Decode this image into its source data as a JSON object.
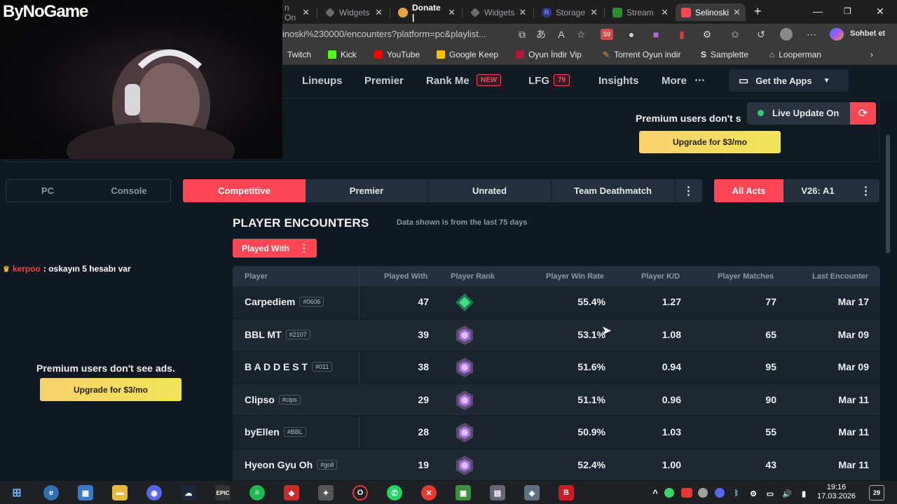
{
  "overlay": {
    "logo": "ByNoGame"
  },
  "browser": {
    "tabs": [
      {
        "label": "n On",
        "active": false
      },
      {
        "label": "Widgets",
        "active": false
      },
      {
        "label": "Donate |",
        "active": false
      },
      {
        "label": "Widgets",
        "active": false
      },
      {
        "label": "Storage",
        "active": false
      },
      {
        "label": "Stream",
        "active": false
      },
      {
        "label": "Selinoski",
        "active": true
      }
    ],
    "url": "linoski%230000/encounters?platform=pc&playlist...",
    "profile_label": "Sohbet et",
    "notif_count": "59",
    "bookmarks": [
      "Twitch",
      "Kick",
      "YouTube",
      "Google Keep",
      "Oyun İndir Vip",
      "Torrent Oyun indir",
      "Samplette",
      "Looperman"
    ]
  },
  "site_nav": {
    "items": [
      "Lineups",
      "Premier",
      "Rank Me",
      "LFG",
      "Insights",
      "More"
    ],
    "new_badge": "NEW",
    "lfg_count": "79",
    "apps_button": "Get the Apps"
  },
  "ad": {
    "top_text": "Premium users don't s",
    "top_button": "Upgrade for $3/mo",
    "side_text": "Premium users don't see ads.",
    "side_button": "Upgrade for $3/mo"
  },
  "live_update": {
    "label": "Live Update On"
  },
  "platform": {
    "options": [
      "PC",
      "Console"
    ]
  },
  "modes": {
    "options": [
      "Competitive",
      "Premier",
      "Unrated",
      "Team Deathmatch"
    ],
    "selected": "Competitive"
  },
  "acts": {
    "options": [
      "All Acts",
      "V26: A1"
    ],
    "selected": "All Acts"
  },
  "section": {
    "title": "PLAYER ENCOUNTERS",
    "note": "Data shown is from the last 75 days",
    "filter_button": "Played With"
  },
  "chat": {
    "user": "kerpoo",
    "message": ": oskayın 5 hesabı var"
  },
  "table": {
    "headers": [
      "Player",
      "Played With",
      "Player Rank",
      "Player Win Rate",
      "Player K/D",
      "Player Matches",
      "Last Encounter"
    ],
    "rows": [
      {
        "name": "Carpediem",
        "tag": "#0606",
        "played": "47",
        "rank": "ascendant",
        "winrate": "55.4%",
        "kd": "1.27",
        "matches": "77",
        "last": "Mar 17"
      },
      {
        "name": "BBL MT",
        "tag": "#2107",
        "played": "39",
        "rank": "immortal",
        "winrate": "53.1%",
        "kd": "1.08",
        "matches": "65",
        "last": "Mar 09"
      },
      {
        "name": "B A D D E S T",
        "tag": "#011",
        "played": "38",
        "rank": "immortal",
        "winrate": "51.6%",
        "kd": "0.94",
        "matches": "95",
        "last": "Mar 09"
      },
      {
        "name": "Clipso",
        "tag": "#cips",
        "played": "29",
        "rank": "immortal",
        "winrate": "51.1%",
        "kd": "0.96",
        "matches": "90",
        "last": "Mar 11"
      },
      {
        "name": "byEllen",
        "tag": "#BBL",
        "played": "28",
        "rank": "immortal",
        "winrate": "50.9%",
        "kd": "1.03",
        "matches": "55",
        "last": "Mar 11"
      },
      {
        "name": "Hyeon Gyu Oh",
        "tag": "#goll",
        "played": "19",
        "rank": "immortal",
        "winrate": "52.4%",
        "kd": "1.00",
        "matches": "43",
        "last": "Mar 11"
      }
    ]
  },
  "taskbar": {
    "time": "19:16",
    "date": "17.03.2026",
    "notif": "29"
  },
  "colors": {
    "accent": "#ff4655",
    "background": "#0f1923",
    "gold": "#f5d560"
  }
}
